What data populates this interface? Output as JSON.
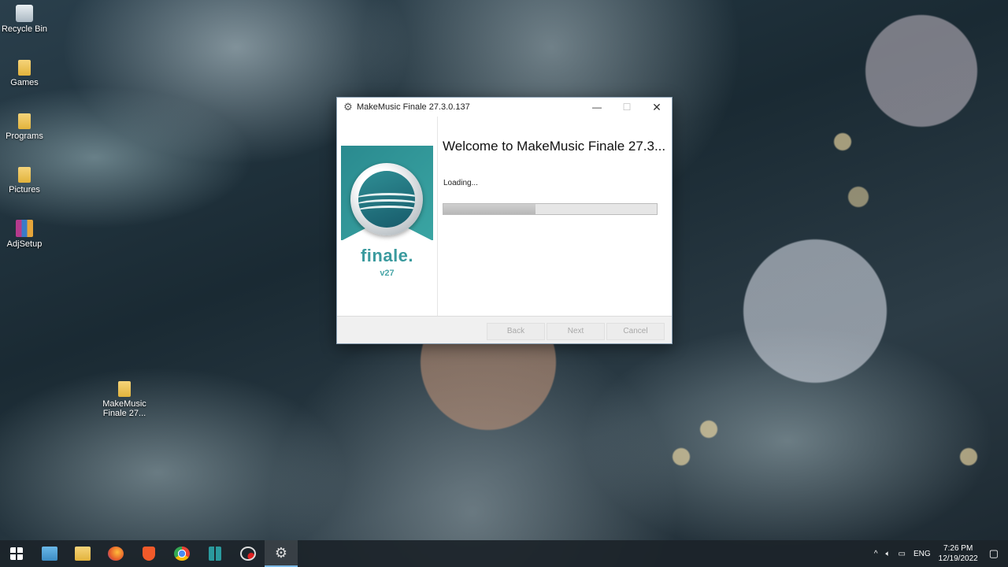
{
  "desktop": {
    "icons": [
      {
        "label": "Recycle Bin",
        "icon": "recycle-bin-icon"
      },
      {
        "label": "Games",
        "icon": "folder-icon"
      },
      {
        "label": "Programs",
        "icon": "folder-icon"
      },
      {
        "label": "Pictures",
        "icon": "folder-icon"
      },
      {
        "label": "AdjSetup",
        "icon": "winrar-icon"
      },
      {
        "label": "MakeMusic Finale 27...",
        "icon": "folder-icon"
      }
    ]
  },
  "installer": {
    "title": "MakeMusic Finale 27.3.0.137",
    "welcome": "Welcome to MakeMusic Finale 27.3...",
    "status": "Loading...",
    "progress": 0.43,
    "brand_name": "finale.",
    "brand_version": "v27",
    "buttons": {
      "back": "Back",
      "next": "Next",
      "cancel": "Cancel"
    },
    "window_controls": {
      "minimize": "—",
      "maximize": "☐",
      "close": "✕"
    }
  },
  "taskbar": {
    "apps": [
      "start",
      "file-explorer",
      "folder",
      "firefox",
      "brave",
      "chrome",
      "app-teal",
      "screen-recorder",
      "settings"
    ],
    "tray": {
      "chevron": "^",
      "language": "ENG",
      "time": "7:26 PM",
      "date": "12/19/2022"
    }
  },
  "colors": {
    "accent": "#3a9a9e",
    "taskbar": "#1c242a"
  }
}
